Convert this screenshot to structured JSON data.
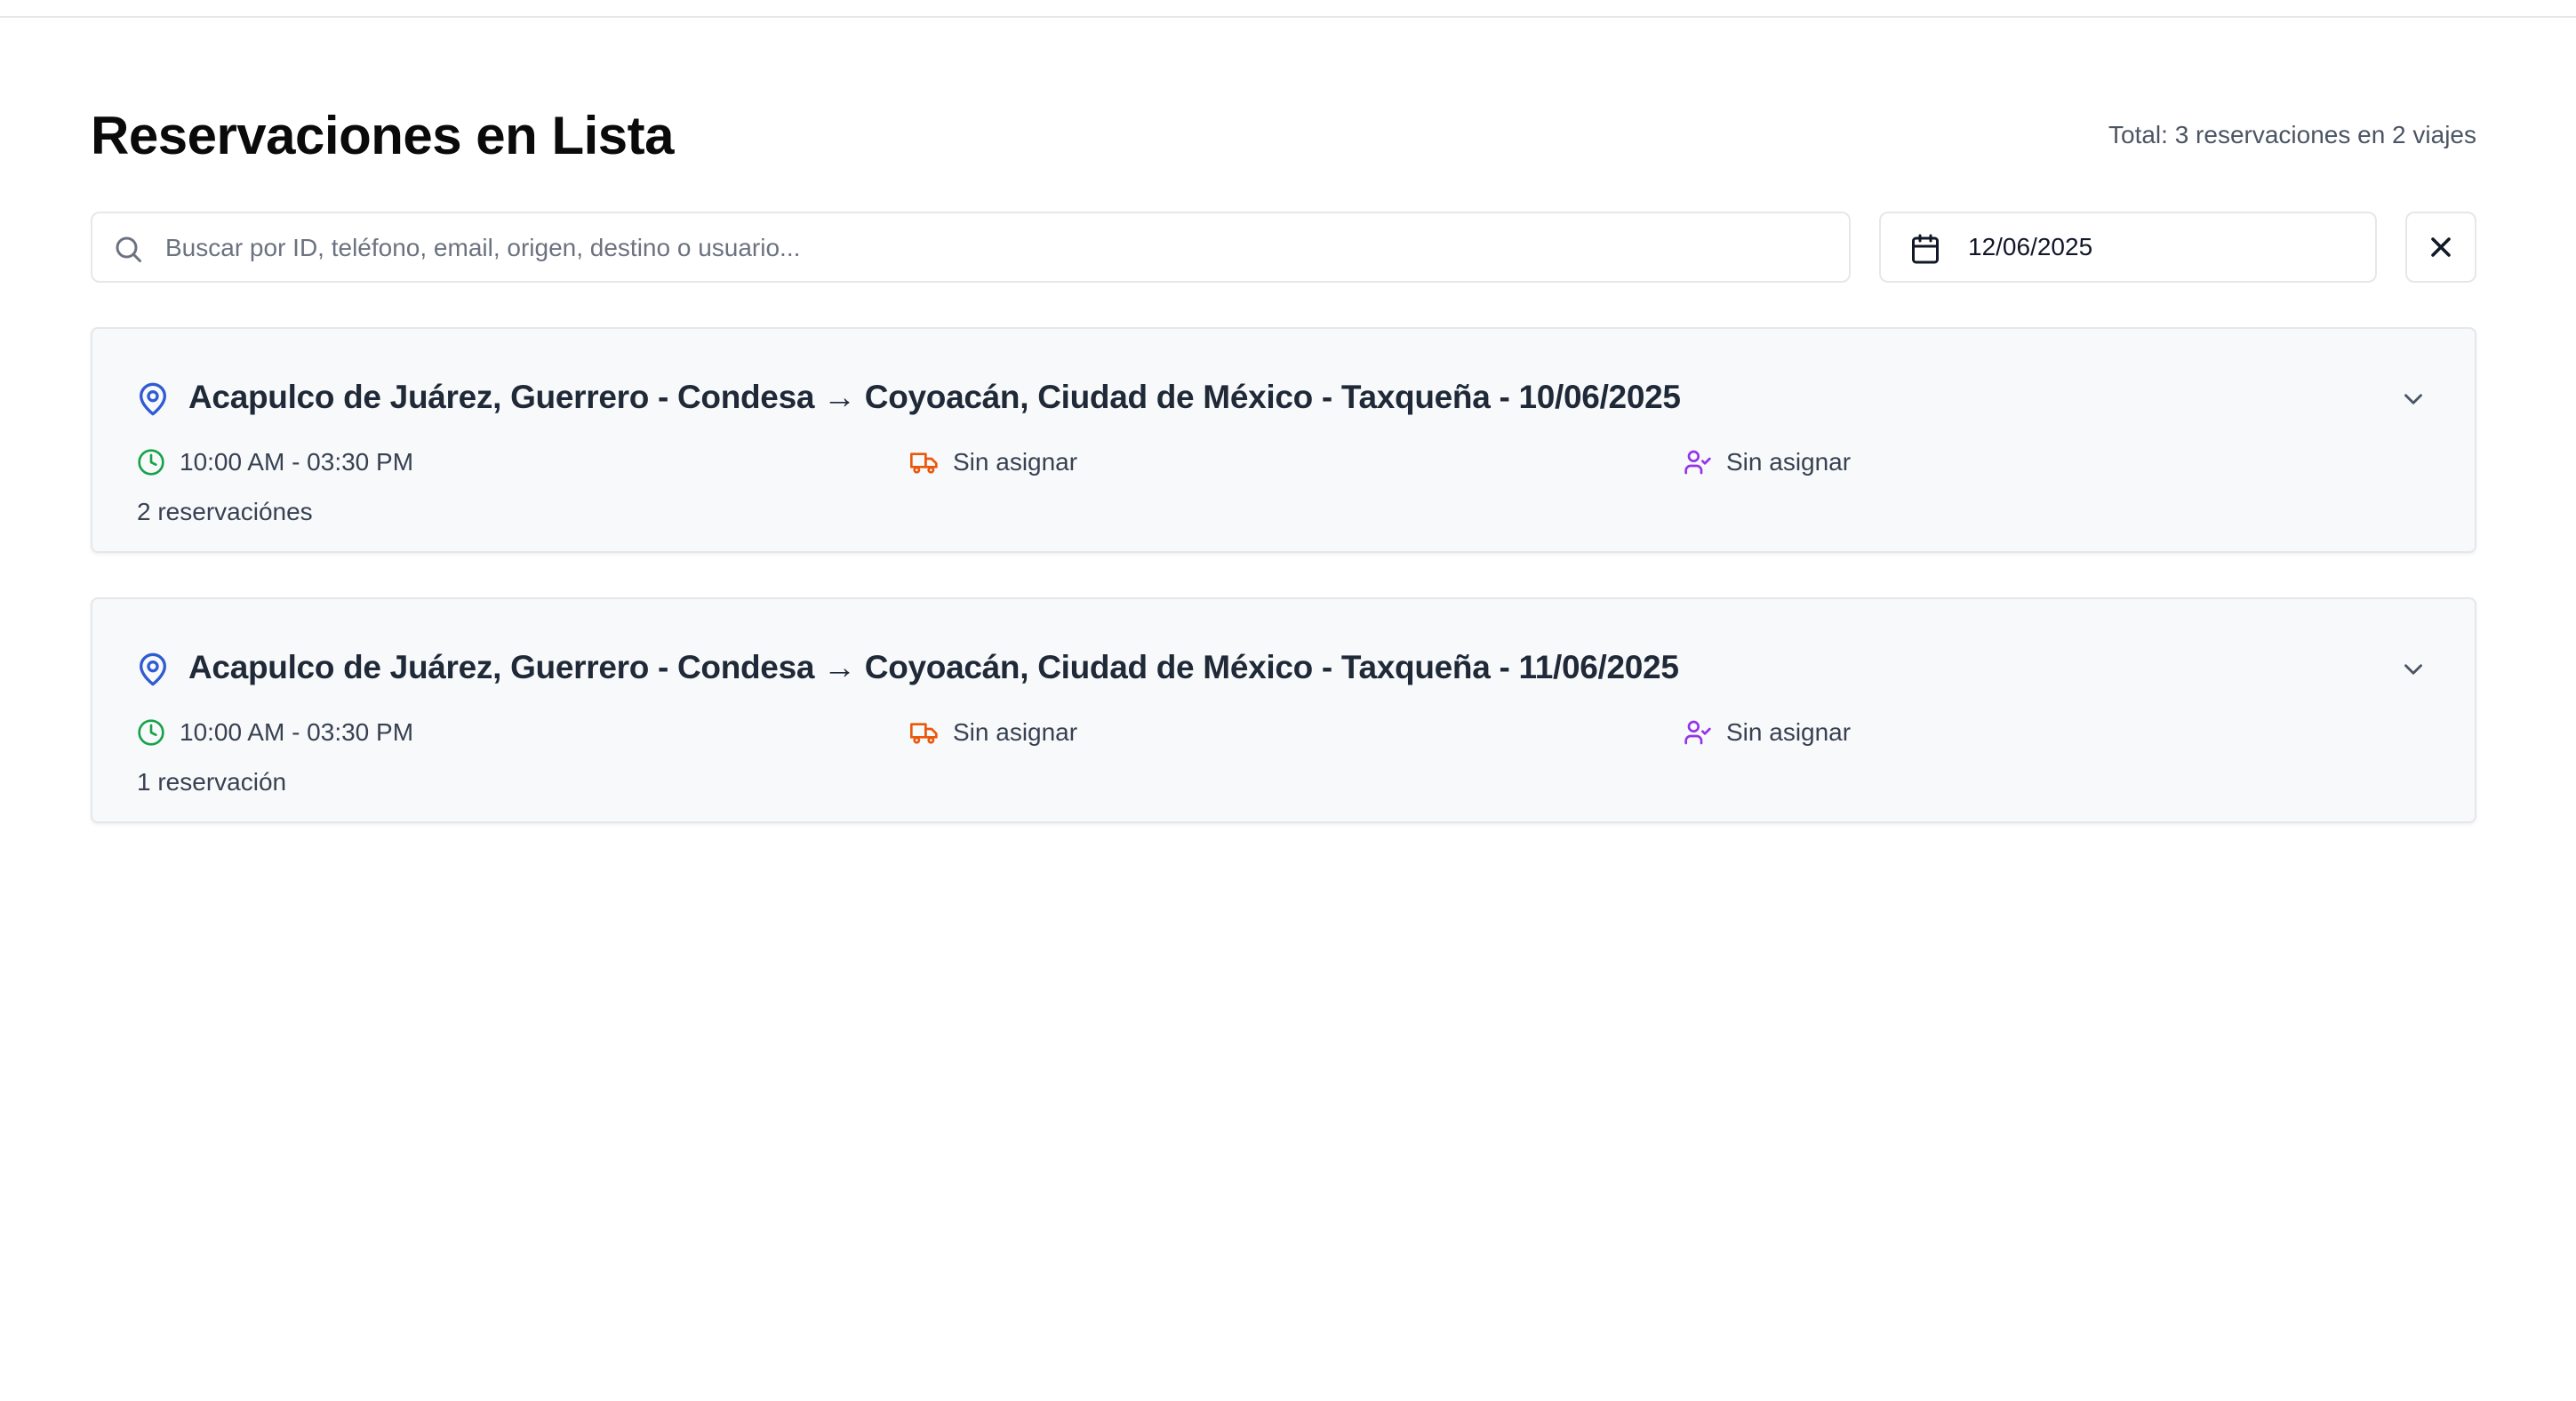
{
  "header": {
    "title": "Reservaciones en Lista",
    "total": "Total: 3 reservaciones en 2 viajes"
  },
  "filters": {
    "search_placeholder": "Buscar por ID, teléfono, email, origen, destino o usuario...",
    "search_value": "",
    "date_value": "12/06/2025"
  },
  "trips": [
    {
      "title": "Acapulco de Juárez, Guerrero - Condesa → Coyoacán, Ciudad de México - Taxqueña - 10/06/2025",
      "time": "10:00 AM - 03:30 PM",
      "vehicle": "Sin asignar",
      "driver": "Sin asignar",
      "count": "2 reservaciónes"
    },
    {
      "title": "Acapulco de Juárez, Guerrero - Condesa → Coyoacán, Ciudad de México - Taxqueña - 11/06/2025",
      "time": "10:00 AM - 03:30 PM",
      "vehicle": "Sin asignar",
      "driver": "Sin asignar",
      "count": "1 reservación"
    }
  ],
  "colors": {
    "pin": "#2f5bd3",
    "clock": "#16a34a",
    "vehicle": "#ea580c",
    "driver": "#9333ea",
    "border": "#e5e7eb",
    "card_bg": "#f8f9fb"
  },
  "icons": {
    "search": "search-icon",
    "calendar": "calendar-icon",
    "clear": "close-icon",
    "pin": "map-pin-icon",
    "clock": "clock-icon",
    "vehicle": "truck-icon",
    "driver": "user-check-icon",
    "expand": "chevron-down-icon"
  }
}
